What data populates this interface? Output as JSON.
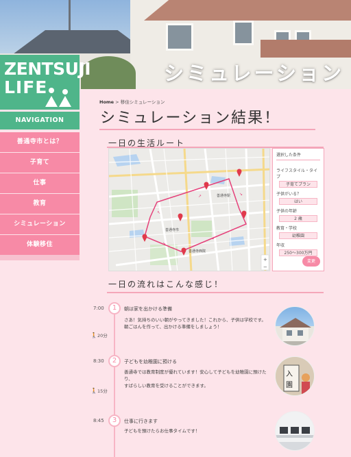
{
  "hero": {
    "title": "シミュレーション"
  },
  "logo": {
    "line1": "ZENTSUJI",
    "line2": "LIFE"
  },
  "navigation": {
    "heading": "NAVIGATION",
    "items": [
      "善通寺市とは？",
      "子育て",
      "仕事",
      "教育",
      "シミュレーション",
      "体験移住"
    ]
  },
  "breadcrumb": {
    "home": "Home",
    "sep": " > ",
    "current": "移住シミュレーション"
  },
  "page": {
    "title": "シミュレーション結果！"
  },
  "route": {
    "title": "一日の生活ルート",
    "map_station": "善通寺駅",
    "map_city": "善通寺市",
    "map_temple": "善通寺西院"
  },
  "conditions": {
    "title": "選択した条件",
    "items": [
      {
        "label": "ライフスタイル・タイプ",
        "value": "子育てプラン"
      },
      {
        "label": "子供がいる？",
        "value": "はい"
      },
      {
        "label": "子供の年齢",
        "value": "2 歳"
      },
      {
        "label": "教育・学校",
        "value": "幼稚園"
      },
      {
        "label": "年収",
        "value": "250〜300万円"
      }
    ],
    "change_button": "変更"
  },
  "flow": {
    "title": "一日の流れはこんな感じ！",
    "steps": [
      {
        "time": "7:00",
        "num": "1",
        "head": "朝は家を出かける準備",
        "body1": "さあ！気持ちのいい朝がやってきました！これから、子供は学校です。",
        "body2": "朝ごはんを作って、出かける準備をしましょう！"
      },
      {
        "time": "8:30",
        "num": "2",
        "head": "子どもを幼稚園に預ける",
        "body1": "善通寺では教育制度が優れています！安心して子どもを幼稚園に預けたり、",
        "body2": "すばらしい教育を受けることができます。"
      },
      {
        "time": "8:45",
        "num": "3",
        "head": "仕事に行きます",
        "body1": "子どもを預けたらお仕事タイムです！",
        "body2": ""
      }
    ],
    "gaps": [
      "20分",
      "15分"
    ]
  },
  "colors": {
    "accent_pink": "#f78aa6",
    "brand_green": "#4fb58a",
    "bg": "#fde4ea"
  }
}
